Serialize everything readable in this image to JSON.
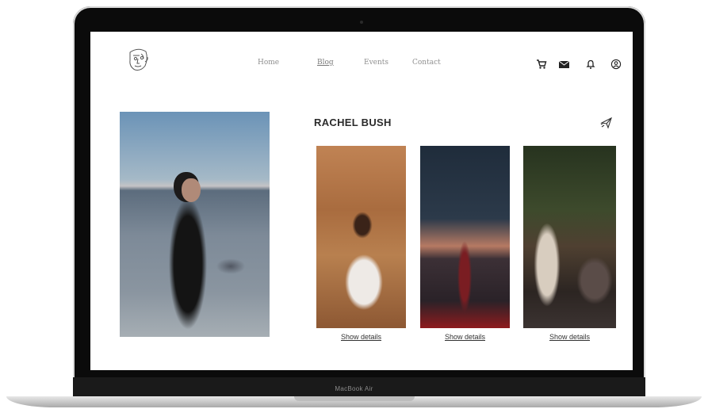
{
  "device": {
    "label": "MacBook Air"
  },
  "nav": {
    "items": [
      {
        "label": "Home",
        "active": false
      },
      {
        "label": "Blog",
        "active": true
      },
      {
        "label": "Events",
        "active": false
      },
      {
        "label": "Contact",
        "active": false
      }
    ]
  },
  "toolbar": {
    "icons": [
      "cart-icon",
      "mail-icon",
      "bell-icon",
      "account-icon"
    ]
  },
  "artist": {
    "name": "RACHEL BUSH",
    "share_icon": "paper-plane-icon"
  },
  "gallery": {
    "cards": [
      {
        "details_label": "Show details"
      },
      {
        "details_label": "Show details"
      },
      {
        "details_label": "Show details"
      }
    ]
  },
  "colors": {
    "text_primary": "#2b2b2b",
    "nav_text": "#8f8f8f",
    "frame": "#0b0b0b"
  }
}
